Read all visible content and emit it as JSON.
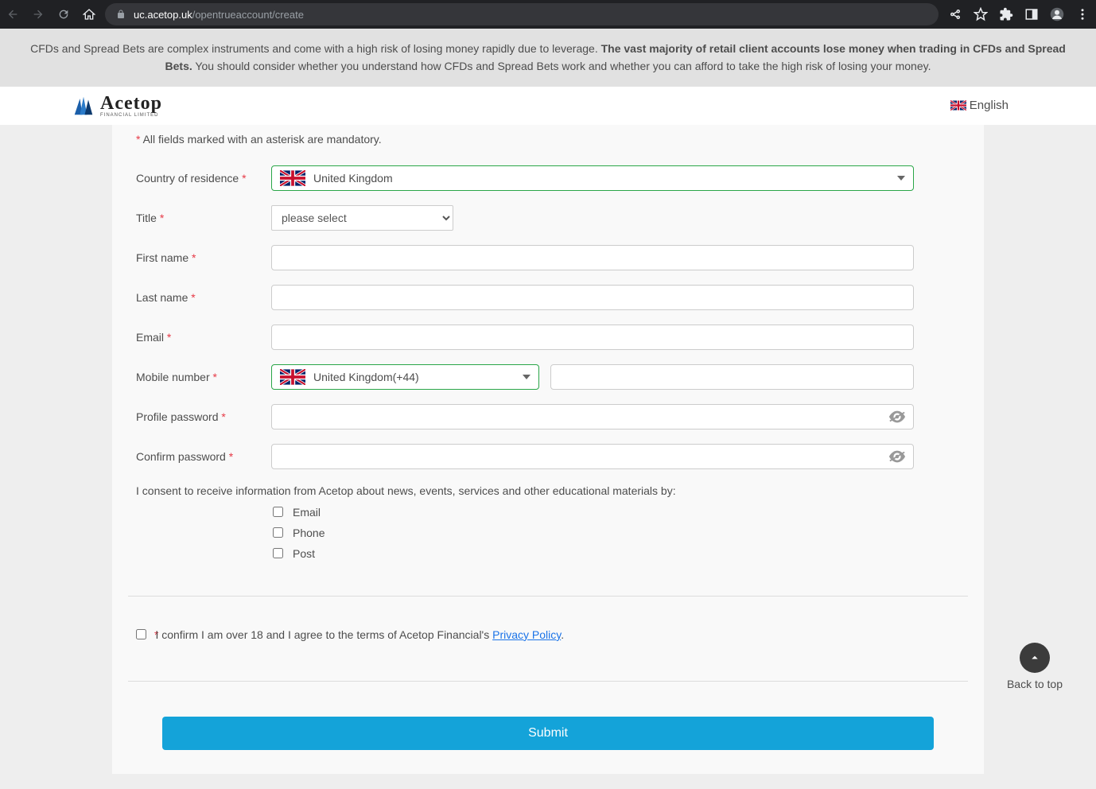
{
  "browser": {
    "url_host": "uc.acetop.uk",
    "url_path": "/opentrueaccount/create"
  },
  "risk_warning": {
    "part1": "CFDs and Spread Bets are complex instruments and come with a high risk of losing money rapidly due to leverage. ",
    "bold": "The vast majority of retail client accounts lose money when trading in CFDs and Spread Bets.",
    "part2": " You should consider whether you understand how CFDs and Spread Bets work and whether you can afford to take the high risk of losing your money."
  },
  "header": {
    "brand": "Acetop",
    "brand_sub": "FINANCIAL LIMITED",
    "language": "English"
  },
  "form": {
    "mandatory_note": " All fields marked with an asterisk are mandatory.",
    "labels": {
      "country": "Country of residence ",
      "title": "Title ",
      "first_name": "First name ",
      "last_name": "Last name ",
      "email": "Email ",
      "mobile": "Mobile number ",
      "profile_pw": "Profile password ",
      "confirm_pw": "Confirm password "
    },
    "values": {
      "country": "United Kingdom",
      "title_placeholder": "please select",
      "mobile_country": "United Kingdom(+44)"
    },
    "consent": {
      "intro": "I consent to receive information from Acetop about news, events, services and other educational materials by:",
      "options": [
        "Email",
        "Phone",
        "Post"
      ]
    },
    "agree": {
      "text": "I confirm I am over 18 and I agree to the terms of Acetop Financial's ",
      "link": "Privacy Policy"
    },
    "submit": "Submit"
  },
  "back_to_top": "Back to top"
}
